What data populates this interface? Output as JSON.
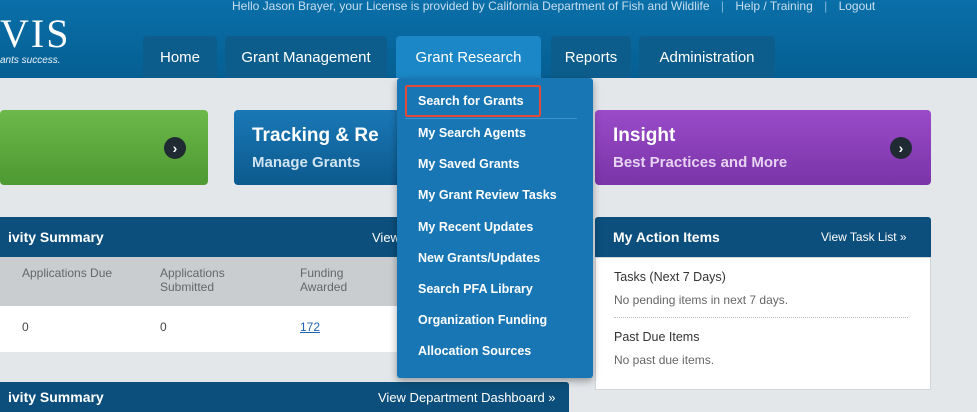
{
  "brand": {
    "logo_text": "VIS",
    "tagline": "ants success."
  },
  "header": {
    "util_text": "Hello Jason Brayer, your License is provided by California Department of Fish and Wildlife",
    "help_link": "Help / Training",
    "logout_link": "Logout"
  },
  "nav": {
    "tabs": [
      {
        "label": "Home"
      },
      {
        "label": "Grant Management"
      },
      {
        "label": "Grant Research"
      },
      {
        "label": "Reports"
      },
      {
        "label": "Administration"
      }
    ]
  },
  "dropdown": {
    "items": [
      "Search for Grants",
      "My Search Agents",
      "My Saved Grants",
      "My Grant Review Tasks",
      "My Recent Updates",
      "New Grants/Updates",
      "Search PFA Library",
      "Organization Funding",
      "Allocation Sources"
    ]
  },
  "tiles": {
    "tracking": {
      "title": "Tracking & Re",
      "subtitle": "Manage Grants"
    },
    "insight": {
      "title": "Insight",
      "subtitle": "Best Practices and More"
    }
  },
  "activity": {
    "title": "ivity Summary",
    "view_link": "View",
    "columns": [
      "Applications Due",
      "Applications Submitted",
      "Funding Awarded"
    ],
    "values": [
      "0",
      "0",
      "172"
    ]
  },
  "department": {
    "title": "ivity Summary",
    "view_link": "View Department Dashboard »"
  },
  "actions": {
    "title": "My Action Items",
    "view_link": "View Task List »",
    "tasks_title": "Tasks (Next 7 Days)",
    "tasks_text": "No pending items in next 7 days.",
    "past_title": "Past Due Items",
    "past_text": "No past due items."
  },
  "colors": {
    "header": "#0a6fa8",
    "active_tab": "#1b87c6",
    "dropdown": "#1876b4",
    "highlight": "#e24a3a",
    "green_tile": "#5ba43c",
    "purple_tile": "#8a3fb8"
  }
}
